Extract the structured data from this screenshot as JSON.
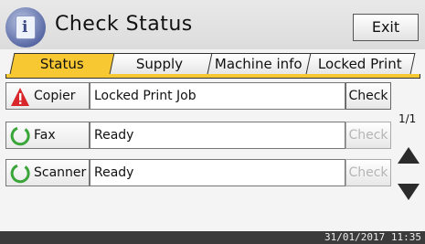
{
  "header": {
    "title": "Check Status",
    "exit_label": "Exit"
  },
  "tabs": [
    {
      "label": "Status",
      "active": true
    },
    {
      "label": "Supply",
      "active": false
    },
    {
      "label": "Machine info",
      "active": false
    },
    {
      "label": "Locked Print",
      "active": false
    }
  ],
  "devices": [
    {
      "name": "Copier",
      "status": "Locked Print Job",
      "check_label": "Check",
      "check_enabled": true,
      "icon": "warning-icon"
    },
    {
      "name": "Fax",
      "status": "Ready",
      "check_label": "Check",
      "check_enabled": false,
      "icon": "ready-ring-icon"
    },
    {
      "name": "Scanner",
      "status": "Ready",
      "check_label": "Check",
      "check_enabled": false,
      "icon": "ready-ring-icon"
    }
  ],
  "pagination": {
    "indicator": "1/1"
  },
  "footer": {
    "timestamp": "31/01/2017 11:35"
  },
  "colors": {
    "accent": "#f7c832",
    "warning": "#d9262a",
    "ready": "#3aa63a"
  }
}
